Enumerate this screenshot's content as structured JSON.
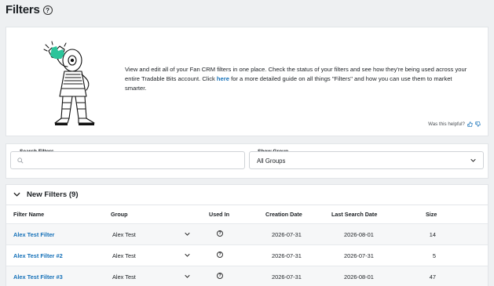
{
  "page": {
    "title": "Filters",
    "help_icon": "?"
  },
  "intro": {
    "text_before_link": "View and edit all of your Fan CRM filters in one place. Check the status of your filters and see how they're being used across your entire Tradable Bits account. Click ",
    "link_label": "here",
    "text_after_link": " for a more detailed guide on all things \"Filters\" and how you can use them to market smarter.",
    "feedback_label": "Was this helpful?",
    "accent_color": "#2bc49a"
  },
  "search": {
    "label": "Search Filters",
    "value": "",
    "placeholder": ""
  },
  "group_select": {
    "label": "Show Group",
    "selected": "All Groups"
  },
  "section": {
    "title": "New Filters (9)"
  },
  "table": {
    "columns": {
      "name": "Filter Name",
      "group": "Group",
      "used_in": "Used In",
      "creation_date": "Creation Date",
      "last_search_date": "Last Search Date",
      "size": "Size"
    },
    "rows": [
      {
        "name": "Alex Test Filter",
        "group": "Alex Test",
        "used_in_icon": "?",
        "creation_date": "2026-07-31",
        "last_search_date": "2026-08-01",
        "size": "14"
      },
      {
        "name": "Alex Test Filter #2",
        "group": "Alex Test",
        "used_in_icon": "?",
        "creation_date": "2026-07-31",
        "last_search_date": "2026-07-31",
        "size": "5"
      },
      {
        "name": "Alex Test Filter #3",
        "group": "Alex Test",
        "used_in_icon": "?",
        "creation_date": "2026-07-31",
        "last_search_date": "2026-08-01",
        "size": "47"
      }
    ]
  }
}
